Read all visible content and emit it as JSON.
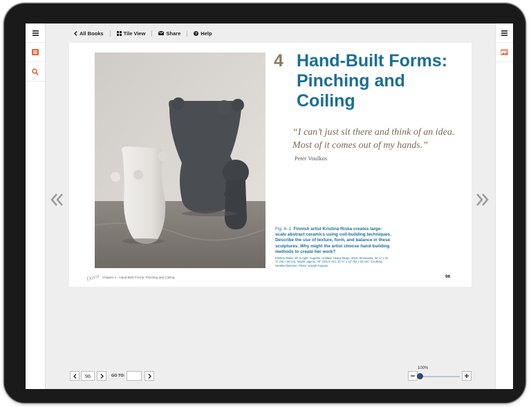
{
  "toolbar": {
    "all_books": "All Books",
    "tile_view": "Tile View",
    "share": "Share",
    "help": "Help"
  },
  "page": {
    "chapter_number": "4",
    "chapter_title": "Hand-Built Forms: Pinching and Coiling",
    "quote": "“I can’t just sit there and think of an idea. Most of it comes out of my hands.”",
    "quote_author": "Peter Voulkos",
    "caption_fig": "Fig. 4–1.",
    "caption_text": "Finnish artist Kristina Riska creates large-scale abstract ceramics using coil-building techniques. Describe the use of texture, form, and balance in these sculptures. Why might the artist choose hand-building methods to create her work?",
    "credit": "Kristina Riska, left to right: Auguste, Untitled, Heavy Bingo, 2019. Stoneware, 32 ¾” x 21 ¾” (83 x 55 cm), height, approx. 40” (101.6 cm), 24 ½” x 12” (62 x 28 cm). Courtesy Heather Bammer. Photo: Joseph Kepano.",
    "footer_logo": "Davis",
    "footer_chapter": "Chapter 4 · Hand-Built Forms: Pinching and Coiling",
    "page_number": "96"
  },
  "pagination": {
    "current_page": "96",
    "goto_label": "GO TO:",
    "goto_value": ""
  },
  "zoom": {
    "label": "100%",
    "level_fraction": 0.0
  },
  "colors": {
    "accent_blue": "#1b6e95",
    "chapter_brown": "#8b7a5e",
    "rail_icon_orange": "#e8603c"
  }
}
